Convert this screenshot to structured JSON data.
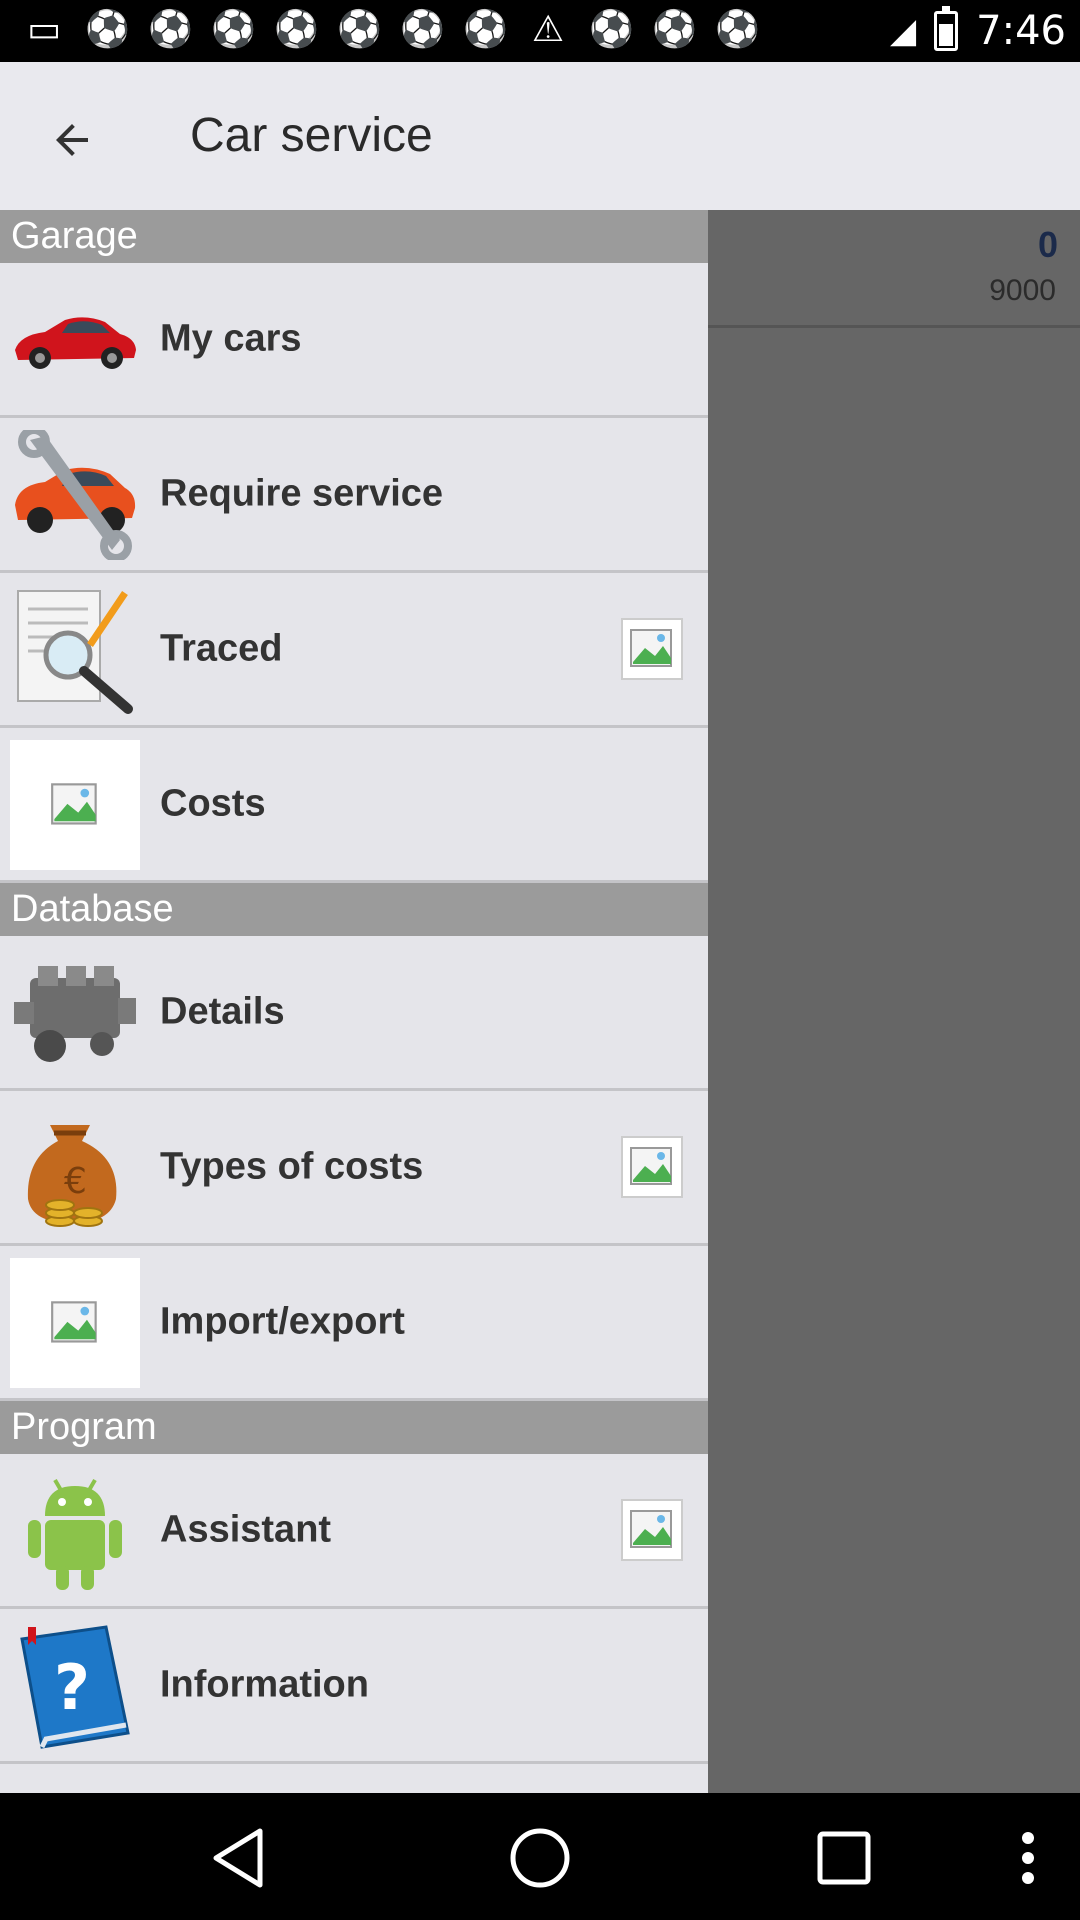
{
  "status_bar": {
    "time": "7:46",
    "notification_icons": [
      "message-icon",
      "soccer-icon",
      "soccer-icon",
      "soccer-icon",
      "soccer-icon",
      "soccer-icon",
      "soccer-icon",
      "soccer-icon",
      "warning-icon",
      "soccer-icon",
      "soccer-icon",
      "soccer-icon"
    ]
  },
  "app_bar": {
    "title": "Car service"
  },
  "background_content": {
    "value_primary": "0",
    "value_secondary": "9000"
  },
  "drawer": {
    "sections": [
      {
        "title": "Garage",
        "items": [
          {
            "label": "My cars",
            "icon": "red-car-icon",
            "badge": false
          },
          {
            "label": "Require service",
            "icon": "car-wrench-icon",
            "badge": false
          },
          {
            "label": "Traced",
            "icon": "document-magnifier-icon",
            "badge": true
          },
          {
            "label": "Costs",
            "icon": "broken-image-icon",
            "badge": false
          }
        ]
      },
      {
        "title": "Database",
        "items": [
          {
            "label": "Details",
            "icon": "engine-icon",
            "badge": false
          },
          {
            "label": "Types of costs",
            "icon": "money-bag-icon",
            "badge": true
          },
          {
            "label": "Import/export",
            "icon": "broken-image-icon",
            "badge": false
          }
        ]
      },
      {
        "title": "Program",
        "items": [
          {
            "label": "Assistant",
            "icon": "android-icon",
            "badge": true
          },
          {
            "label": "Information",
            "icon": "help-book-icon",
            "badge": false
          }
        ]
      }
    ]
  },
  "colors": {
    "appbar_bg": "#e9e9ee",
    "drawer_bg": "#e5e5ea",
    "section_header_bg": "#9b9b9b",
    "scrim": "#666666"
  }
}
